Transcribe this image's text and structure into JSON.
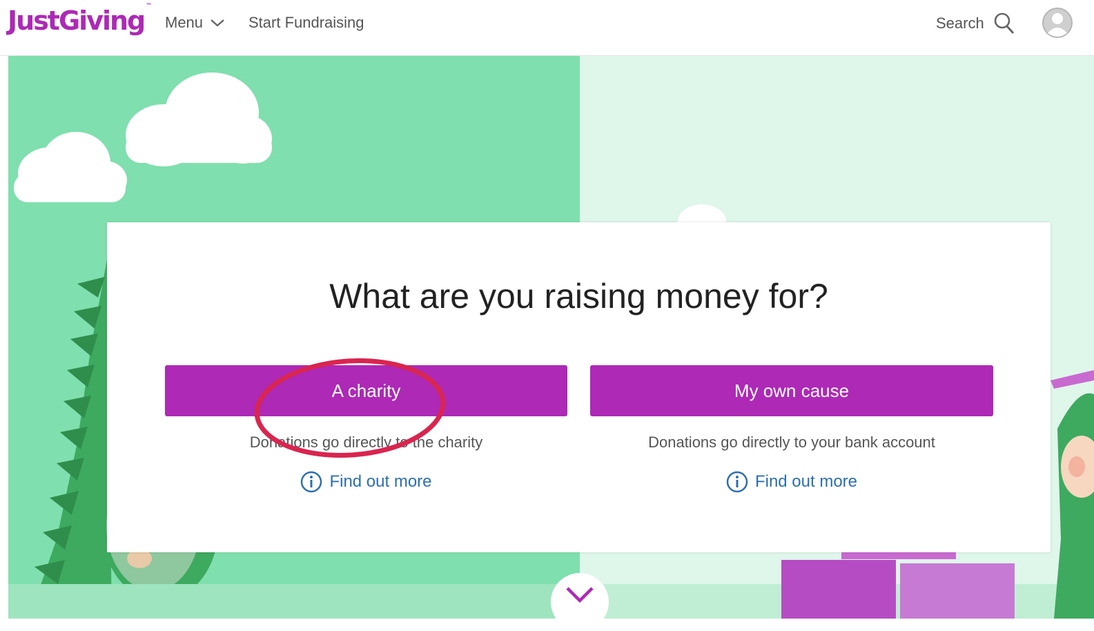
{
  "header": {
    "logo_text": "JustGiving",
    "logo_tm": "™",
    "menu_label": "Menu",
    "start_fundraising_label": "Start Fundraising",
    "search_label": "Search"
  },
  "main": {
    "heading": "What are you raising money for?",
    "options": [
      {
        "button_label": "A charity",
        "description": "Donations go directly to the charity",
        "link_label": "Find out more"
      },
      {
        "button_label": "My own cause",
        "description": "Donations go directly to your bank account",
        "link_label": "Find out more"
      }
    ]
  },
  "colors": {
    "brand_purple": "#ad29b6",
    "hero_green": "#7fdfae",
    "hero_light_green": "#dff6ea",
    "link_blue": "#2c6fb0",
    "annotation_red": "#d9254f"
  },
  "icons": [
    "chevron-down-icon",
    "search-icon",
    "user-avatar-icon",
    "info-icon",
    "scroll-down-chevron-icon"
  ]
}
